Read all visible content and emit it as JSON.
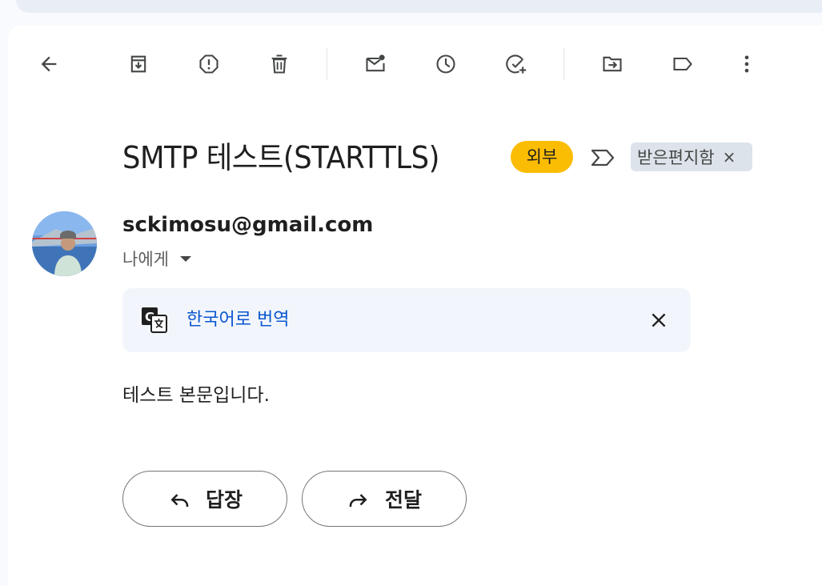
{
  "toolbar": {
    "icons": [
      "back-arrow-icon",
      "archive-icon",
      "report-spam-icon",
      "delete-icon",
      "mark-unread-icon",
      "snooze-icon",
      "add-to-tasks-icon",
      "move-to-icon",
      "label-icon",
      "more-vert-icon"
    ]
  },
  "email": {
    "subject": "SMTP 테스트(STARTTLS)",
    "external_badge": "외부",
    "label": "받은편지함",
    "label_remove": "×",
    "sender": "sckimosu@gmail.com",
    "recipient": "나에게",
    "translate_link": "한국어로 번역",
    "body": "테스트 본문입니다.",
    "reply_label": "답장",
    "forward_label": "전달"
  },
  "colors": {
    "badge": "#fbbc04",
    "link": "#0b57d0",
    "label_chip": "#dde3ea",
    "translate_bg": "#f2f6fc"
  }
}
